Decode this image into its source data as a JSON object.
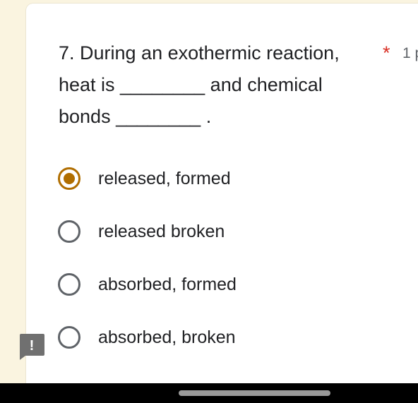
{
  "question": {
    "line1": "7. During an exothermic reaction,",
    "line2": "heat is ________  and chemical",
    "line3": "bonds ________ .",
    "required_mark": "*",
    "points": "1 p"
  },
  "options": [
    {
      "label": "released, formed",
      "selected": true
    },
    {
      "label": "released broken",
      "selected": false
    },
    {
      "label": "absorbed, formed",
      "selected": false
    },
    {
      "label": "absorbed, broken",
      "selected": false
    }
  ],
  "alert": {
    "icon": "exclamation-alert-icon",
    "symbol": "!"
  },
  "colors": {
    "background": "#faf4e0",
    "accent": "#b06e00",
    "required": "#d93025",
    "alert": "#707070"
  }
}
